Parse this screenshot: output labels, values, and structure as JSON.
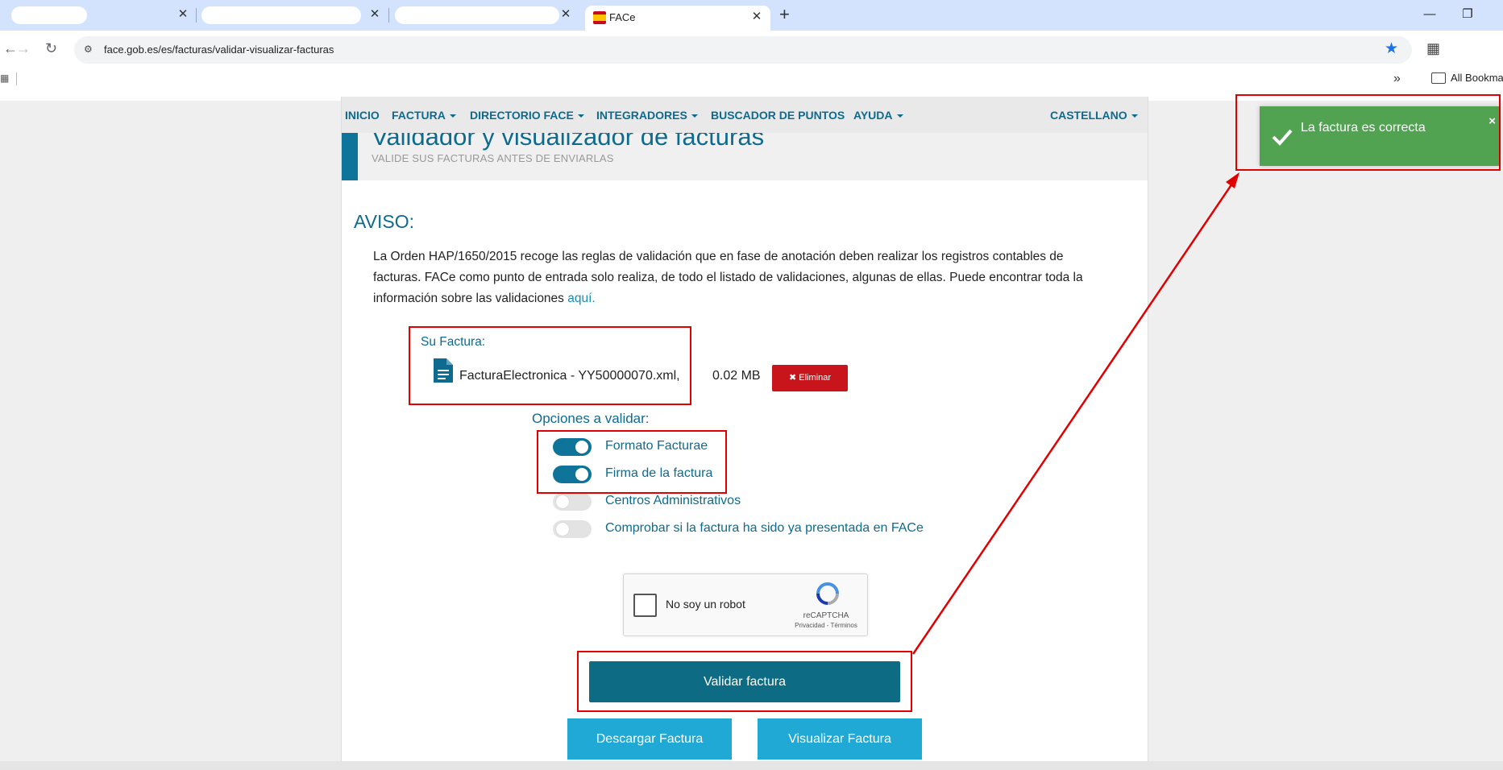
{
  "browser": {
    "active_tab_title": "FACe",
    "url": "face.gob.es/es/facturas/validar-visualizar-facturas",
    "bookmarks_label": "All Bookmar",
    "tab_close": "✕",
    "new_tab": "+"
  },
  "nav": {
    "items": [
      {
        "label": "INICIO",
        "dropdown": false
      },
      {
        "label": "FACTURA",
        "dropdown": true
      },
      {
        "label": "DIRECTORIO FACE",
        "dropdown": true
      },
      {
        "label": "INTEGRADORES",
        "dropdown": true
      },
      {
        "label": "BUSCADOR DE PUNTOS",
        "dropdown": false
      },
      {
        "label": "AYUDA",
        "dropdown": true
      }
    ],
    "language": "CASTELLANO"
  },
  "hero": {
    "title": "Validador y visualizador de facturas",
    "subtitle": "VALIDE SUS FACTURAS ANTES DE ENVIARLAS"
  },
  "aviso": {
    "title": "AVISO:",
    "text": "La Orden HAP/1650/2015 recoge las reglas de validación que en fase de anotación deben realizar los registros contables de facturas. FACe como punto de entrada solo realiza, de todo el listado de validaciones, algunas de ellas. Puede encontrar toda la información sobre las validaciones ",
    "link": "aquí."
  },
  "file": {
    "label": "Su Factura:",
    "name": "FacturaElectronica - YY50000070.xml,",
    "size": "0.02 MB",
    "delete_label": "✖ Eliminar",
    "icon": "file-document-icon"
  },
  "options": {
    "label": "Opciones a validar:",
    "items": [
      {
        "label": "Formato Facturae",
        "checked": true
      },
      {
        "label": "Firma de la factura",
        "checked": true
      },
      {
        "label": "Centros Administrativos",
        "checked": false
      },
      {
        "label": "Comprobar si la factura ha sido ya presentada en FACe",
        "checked": false
      }
    ]
  },
  "captcha": {
    "label": "No soy un robot",
    "brand": "reCAPTCHA",
    "links": "Privacidad - Términos"
  },
  "buttons": {
    "validate": "Validar factura",
    "download": "Descargar Factura",
    "view": "Visualizar Factura"
  },
  "toast": {
    "message": "La factura es correcta",
    "close": "×",
    "color": "#51a351"
  },
  "colors": {
    "brand": "#0e6b8f",
    "danger": "#c7151b",
    "annotation": "#e10000"
  }
}
